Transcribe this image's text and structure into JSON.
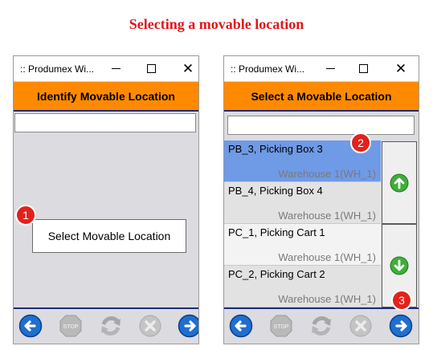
{
  "doc_title": "Selecting a movable location",
  "left_window": {
    "title": ":: Produmex Wi...",
    "header": "Identify Movable Location",
    "input_value": "",
    "select_button_label": "Select Movable Location"
  },
  "right_window": {
    "title": ":: Produmex Wi...",
    "header": "Select a Movable Location",
    "input_value": "",
    "locations": [
      {
        "name": "PB_3, Picking Box 3",
        "warehouse": "Warehouse 1(WH_1)",
        "selected": true
      },
      {
        "name": "PB_4, Picking Box 4",
        "warehouse": "Warehouse 1(WH_1)",
        "selected": false
      },
      {
        "name": "PC_1, Picking Cart 1",
        "warehouse": "Warehouse 1(WH_1)",
        "selected": false
      },
      {
        "name": "PC_2, Picking Cart 2",
        "warehouse": "Warehouse 1(WH_1)",
        "selected": false
      }
    ]
  },
  "window_controls": {
    "minimize": "—",
    "maximize": "☐",
    "close": "✕"
  },
  "bottom_bar_icons": [
    "back-arrow-icon",
    "stop-icon",
    "refresh-icon",
    "cancel-icon",
    "next-arrow-icon"
  ],
  "stop_label": "STOP",
  "badges": [
    "1",
    "2",
    "3"
  ],
  "colors": {
    "accent_orange": "#ff8a00",
    "nav_blue": "#1f6fd0",
    "selected_row": "#6f9ae6",
    "badge_red": "#e3211c",
    "title_red": "#e0161b"
  }
}
